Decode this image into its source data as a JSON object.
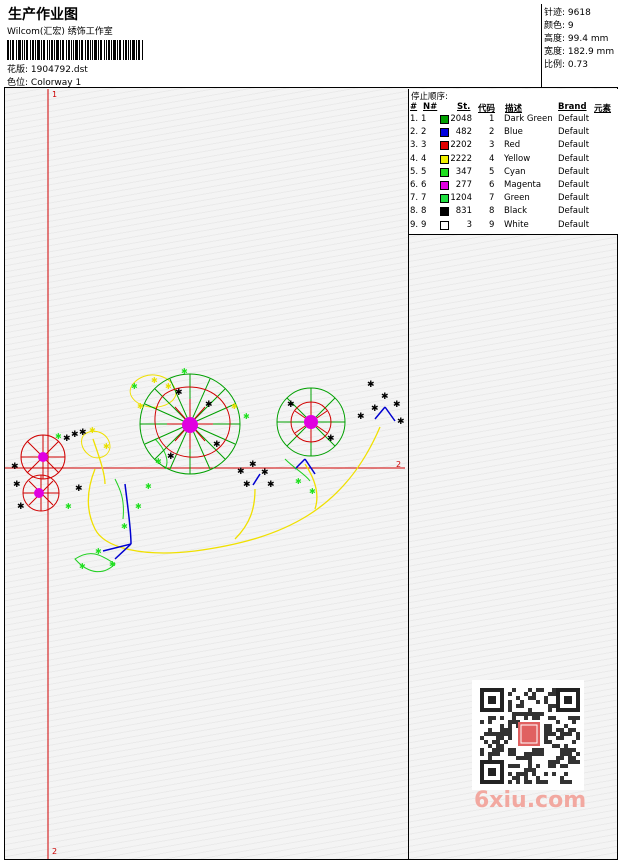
{
  "header": {
    "title": "生产作业图",
    "company": "Wilcom(汇宏) 绣饰工作室",
    "design_label": "花版:",
    "design_file": "1904792.dst",
    "colorway_label": "色位:",
    "colorway": "Colorway 1"
  },
  "info": {
    "stitches_label": "针迹:",
    "stitches": "9618",
    "colors_label": "颜色:",
    "colors": "9",
    "height_label": "高度:",
    "height": "99.4 mm",
    "width_label": "宽度:",
    "width": "182.9 mm",
    "scale_label": "比例:",
    "scale": "0.73"
  },
  "stop_sequence": {
    "title": "停止顺序:",
    "columns": [
      "#",
      "N#",
      "St.",
      "代码",
      "描述",
      "Brand",
      "元素"
    ],
    "rows": [
      {
        "num": "1.",
        "n": "1",
        "color": "#00a000",
        "st": "2048",
        "code": "1",
        "desc": "Dark Green",
        "brand": "Default"
      },
      {
        "num": "2.",
        "n": "2",
        "color": "#0000e0",
        "st": "482",
        "code": "2",
        "desc": "Blue",
        "brand": "Default"
      },
      {
        "num": "3.",
        "n": "3",
        "color": "#e00000",
        "st": "2202",
        "code": "3",
        "desc": "Red",
        "brand": "Default"
      },
      {
        "num": "4.",
        "n": "4",
        "color": "#f0f000",
        "st": "2222",
        "code": "4",
        "desc": "Yellow",
        "brand": "Default"
      },
      {
        "num": "5.",
        "n": "5",
        "color": "#20e020",
        "st": "347",
        "code": "5",
        "desc": "Cyan",
        "brand": "Default"
      },
      {
        "num": "6.",
        "n": "6",
        "color": "#e000e0",
        "st": "277",
        "code": "6",
        "desc": "Magenta",
        "brand": "Default"
      },
      {
        "num": "7.",
        "n": "7",
        "color": "#20e040",
        "st": "1204",
        "code": "7",
        "desc": "Green",
        "brand": "Default"
      },
      {
        "num": "8.",
        "n": "8",
        "color": "#000000",
        "st": "831",
        "code": "8",
        "desc": "Black",
        "brand": "Default"
      },
      {
        "num": "9.",
        "n": "9",
        "color": "#ffffff",
        "st": "3",
        "code": "9",
        "desc": "White",
        "brand": "Default"
      }
    ]
  },
  "canvas": {
    "axis_top": "1",
    "axis_right": "2",
    "axis_bottom": "2"
  },
  "watermark": "6xiu.com"
}
